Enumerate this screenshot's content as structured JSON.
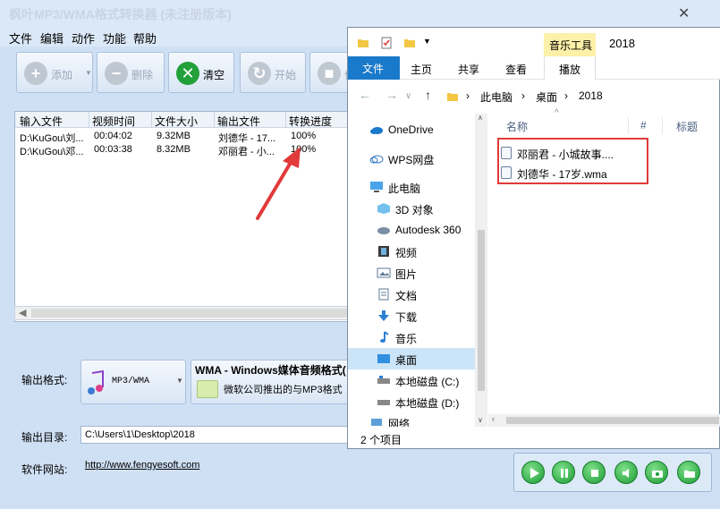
{
  "app": {
    "title": "枫叶MP3/WMA格式转换器  (未注册版本)",
    "close": "✕"
  },
  "menu": [
    "文件",
    "编辑",
    "动作",
    "功能",
    "帮助"
  ],
  "toolbar": {
    "add": "添加",
    "delete": "删除",
    "clear": "清空",
    "start": "开始",
    "stop": "停"
  },
  "filelist": {
    "headers": [
      "输入文件",
      "视频时间",
      "文件大小",
      "输出文件",
      "转换进度"
    ],
    "rows": [
      [
        "D:\\KuGou\\刘...",
        "00:04:02",
        "9.32MB",
        "刘德华 - 17...",
        "100%"
      ],
      [
        "D:\\KuGou\\邓...",
        "00:03:38",
        "8.32MB",
        "邓丽君 - 小...",
        "100%"
      ]
    ]
  },
  "settings": {
    "format_label": "输出格式:",
    "format_value": "MP3/WMA",
    "format_name": "WMA - Windows媒体音频格式(",
    "format_desc": "微软公司推出的与MP3格式",
    "outdir_label": "输出目录:",
    "outdir_value": "C:\\Users\\1\\Desktop\\2018",
    "website_label": "软件网站:",
    "website_value": "http://www.fengyesoft.com"
  },
  "explorer": {
    "music_tools": "音乐工具",
    "folder_name": "2018",
    "tabs": [
      "文件",
      "主页",
      "共享",
      "查看"
    ],
    "play_tab": "播放",
    "breadcrumb": [
      "此电脑",
      "桌面",
      "2018"
    ],
    "nav": [
      {
        "label": "OneDrive",
        "icon": "cloud-icon"
      },
      {
        "label": "WPS网盘",
        "icon": "cloud-outline-icon"
      },
      {
        "label": "此电脑",
        "icon": "computer-icon"
      },
      {
        "label": "3D 对象",
        "icon": "cube-icon"
      },
      {
        "label": "Autodesk 360",
        "icon": "autodesk-icon"
      },
      {
        "label": "视频",
        "icon": "film-icon"
      },
      {
        "label": "图片",
        "icon": "picture-icon"
      },
      {
        "label": "文档",
        "icon": "document-icon"
      },
      {
        "label": "下载",
        "icon": "download-icon"
      },
      {
        "label": "音乐",
        "icon": "music-icon"
      },
      {
        "label": "桌面",
        "icon": "desktop-icon"
      },
      {
        "label": "本地磁盘 (C:)",
        "icon": "disk-icon"
      },
      {
        "label": "本地磁盘 (D:)",
        "icon": "disk-icon"
      },
      {
        "label": "网络",
        "icon": "network-icon"
      }
    ],
    "columns": [
      "名称",
      "#",
      "标题"
    ],
    "files": [
      "邓丽君 - 小城故事....",
      "刘德华 - 17岁.wma"
    ],
    "status": "2 个项目",
    "colors": {
      "accent": "#1979ca",
      "highlight": "#e03a3a",
      "music_tools": "#fdf0a8"
    }
  }
}
